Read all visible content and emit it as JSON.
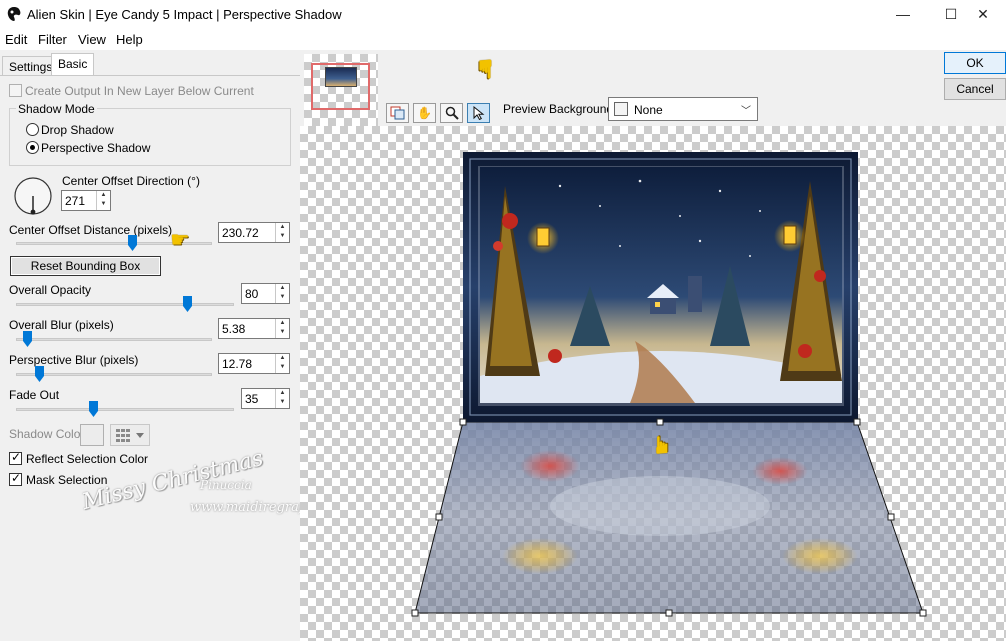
{
  "window": {
    "title": "Alien Skin | Eye Candy 5 Impact | Perspective Shadow",
    "min_glyph": "—",
    "max_glyph": "☐",
    "close_glyph": "✕"
  },
  "menu": [
    "Edit",
    "Filter",
    "View",
    "Help"
  ],
  "tabs": [
    "Settings",
    "Basic"
  ],
  "active_tab": "Basic",
  "basic": {
    "create_output_label": "Create Output In New Layer Below Current",
    "create_output_checked": false,
    "shadow_mode_label": "Shadow Mode",
    "shadow_modes": [
      "Drop Shadow",
      "Perspective Shadow"
    ],
    "shadow_mode_selected": "Perspective Shadow",
    "center_offset_direction_label": "Center Offset Direction (°)",
    "center_offset_direction_value": "271",
    "center_offset_distance_label": "Center Offset Distance (pixels)",
    "center_offset_distance_value": "230.72",
    "center_offset_distance_slider": 0.6,
    "reset_bounding_box_label": "Reset Bounding Box",
    "overall_opacity_label": "Overall Opacity",
    "overall_opacity_value": "80",
    "overall_opacity_slider": 0.8,
    "overall_blur_label": "Overall Blur (pixels)",
    "overall_blur_value": "5.38",
    "overall_blur_slider": 0.04,
    "perspective_blur_label": "Perspective Blur (pixels)",
    "perspective_blur_value": "12.78",
    "perspective_blur_slider": 0.1,
    "fade_out_label": "Fade Out",
    "fade_out_value": "35",
    "fade_out_slider": 0.35,
    "shadow_color_label": "Shadow Color",
    "reflect_selection_label": "Reflect Selection Color",
    "reflect_selection_checked": true,
    "mask_selection_label": "Mask Selection",
    "mask_selection_checked": true
  },
  "watermark": {
    "script_text": "Missy Christmas",
    "name": "Pinuccia",
    "url": "www.maidiregrafica.eu"
  },
  "toolbar": {
    "preview_background_label": "Preview Background:",
    "preview_background_value": "None"
  },
  "buttons": {
    "ok": "OK",
    "cancel": "Cancel"
  },
  "colors": {
    "accent_blue": "#0078d7",
    "pointer_yellow": "#f2c200",
    "thumbnail_frame": "#e06a6a"
  }
}
